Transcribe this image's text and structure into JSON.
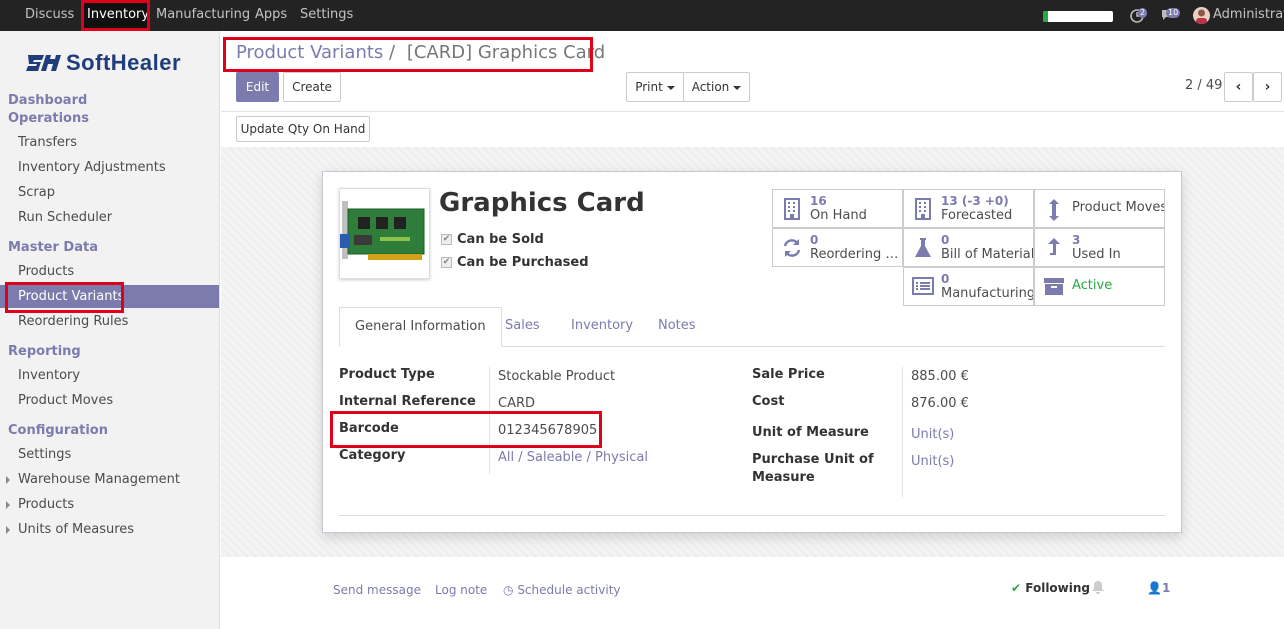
{
  "topbar": {
    "menus": [
      "Discuss",
      "Inventory",
      "Manufacturing",
      "Apps",
      "Settings"
    ],
    "activity_count": "2",
    "message_count": "10",
    "user": "Administrator"
  },
  "logo": {
    "text": "SoftHealer"
  },
  "sidebar": {
    "sections": {
      "dashboard": "Dashboard",
      "operations": "Operations",
      "master_data": "Master Data",
      "reporting": "Reporting",
      "configuration": "Configuration"
    },
    "operations_items": [
      "Transfers",
      "Inventory Adjustments",
      "Scrap",
      "Run Scheduler"
    ],
    "master_items": [
      "Products",
      "Product Variants",
      "Reordering Rules"
    ],
    "reporting_items": [
      "Inventory",
      "Product Moves"
    ],
    "config_items": [
      "Settings",
      "Warehouse Management",
      "Products",
      "Units of Measures"
    ]
  },
  "breadcrumb": {
    "parent": "Product Variants",
    "separator": "/",
    "current": "[CARD] Graphics Card"
  },
  "actions": {
    "edit": "Edit",
    "create": "Create",
    "print": "Print",
    "action": "Action",
    "update_qty": "Update Qty On Hand"
  },
  "pager": {
    "value": "2 / 49"
  },
  "product": {
    "name": "Graphics Card",
    "can_be_sold": "Can be Sold",
    "can_be_purchased": "Can be Purchased"
  },
  "smart_buttons": {
    "on_hand": {
      "num": "16",
      "label": "On Hand"
    },
    "forecasted": {
      "num": "13 (-3 +0)",
      "label": "Forecasted"
    },
    "product_moves": {
      "label": "Product Moves"
    },
    "reordering": {
      "num": "0",
      "label": "Reordering Rules"
    },
    "bom": {
      "num": "0",
      "label": "Bill of Materials"
    },
    "used_in": {
      "num": "3",
      "label": "Used In"
    },
    "manufacturing": {
      "num": "0",
      "label": "Manufacturing"
    },
    "active": {
      "label": "Active"
    }
  },
  "tabs": [
    "General Information",
    "Sales",
    "Inventory",
    "Notes"
  ],
  "fields": {
    "product_type": {
      "label": "Product Type",
      "value": "Stockable Product"
    },
    "internal_ref": {
      "label": "Internal Reference",
      "value": "CARD"
    },
    "barcode": {
      "label": "Barcode",
      "value": "012345678905"
    },
    "category": {
      "label": "Category",
      "value": "All / Saleable / Physical"
    },
    "sale_price": {
      "label": "Sale Price",
      "value": "885.00 €"
    },
    "cost": {
      "label": "Cost",
      "value": "876.00 €"
    },
    "uom": {
      "label": "Unit of Measure",
      "value": "Unit(s)"
    },
    "purchase_uom_line1": "Purchase Unit of",
    "purchase_uom_line2": "Measure",
    "purchase_uom_value": "Unit(s)"
  },
  "chatter": {
    "send_message": "Send message",
    "log_note": "Log note",
    "schedule_activity": "Schedule activity",
    "following": "Following",
    "followers": "1"
  },
  "colors": {
    "brand": "#7c7bad",
    "highlight": "#e0001b",
    "topbar": "#232323",
    "active_green": "#28a745"
  }
}
